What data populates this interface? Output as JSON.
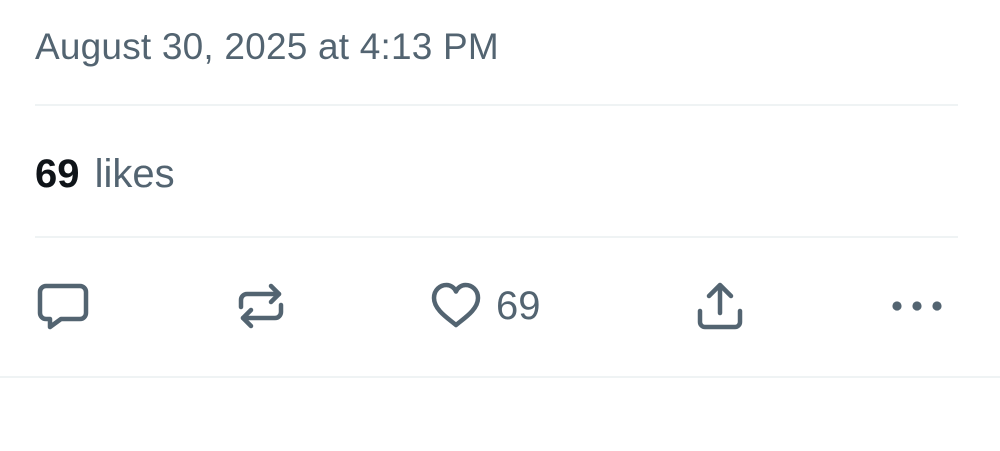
{
  "tweet": {
    "timestamp": "August 30, 2025 at 4:13 PM",
    "likes": {
      "count": "69",
      "label": "likes"
    }
  },
  "actions": {
    "reply": {
      "icon": "reply-icon"
    },
    "repost": {
      "icon": "repost-icon"
    },
    "like": {
      "icon": "heart-icon",
      "count": "69"
    },
    "share": {
      "icon": "share-icon"
    },
    "more": {
      "icon": "more-icon"
    }
  },
  "colors": {
    "secondary_text": "#536471",
    "primary_text": "#0f1419",
    "divider": "#eff3f4",
    "background": "#ffffff"
  }
}
